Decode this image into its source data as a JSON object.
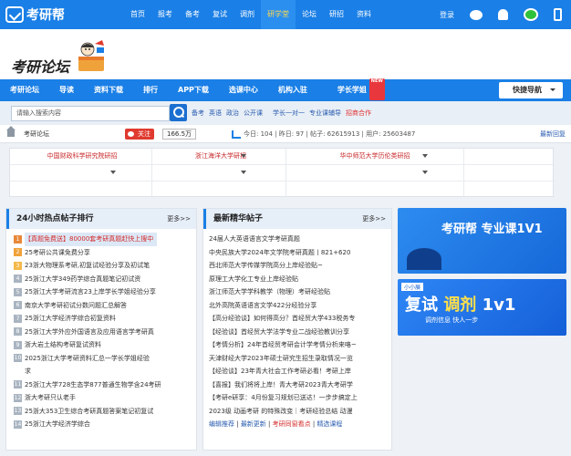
{
  "topbar": {
    "logo": "考研帮",
    "nav": [
      "首页",
      "报考",
      "备考",
      "复试",
      "调剂",
      "研学堂",
      "论坛",
      "研招",
      "资料"
    ],
    "highlight_index": 5,
    "login": "登录",
    "icons": [
      "weibo-icon",
      "bell-icon",
      "wechat-icon",
      "phone-icon"
    ]
  },
  "brand": {
    "title": "考研论坛"
  },
  "mainnav": {
    "items": [
      "考研论坛",
      "导读",
      "资料下载",
      "排行",
      "APP下载",
      "选课中心",
      "机构入驻",
      "学长学姐"
    ],
    "new_badge": "NEW",
    "quick": "快捷导航"
  },
  "search": {
    "placeholder": "请输入搜索内容",
    "tags": [
      "备考",
      "英语",
      "政治",
      "公开课",
      "学长一对一",
      "专业课辅导",
      "招商合作"
    ]
  },
  "stats": {
    "crumb": "考研论坛",
    "follow": "关注",
    "follow_count": "166.5万",
    "today_label": "今日: 104",
    "yesterday_label": "昨日: 97",
    "threads_label": "帖子: 62615913",
    "users_label": "用户: 25603487",
    "newest": "最新回复"
  },
  "link_grid": {
    "row1": [
      "中国财政科学研究院研招",
      "浙江海洋大学研招",
      "华中师范大学历伦类研招"
    ]
  },
  "hot": {
    "title": "24小时热点帖子排行",
    "more": "更多>>",
    "items": [
      {
        "n": "1",
        "text": "【真题免费送】80000套考研真题赶快上搜中"
      },
      {
        "n": "2",
        "text": "25考研公共课免费分享"
      },
      {
        "n": "3",
        "text": "23浙大物理系考研,初复试经验分享及初试笔"
      },
      {
        "n": "4",
        "text": "25浙江大学349药学综合真题笔记初试资"
      },
      {
        "n": "5",
        "text": "25浙江大学考研流言23上岸学长学姐经验分享"
      },
      {
        "n": "6",
        "text": "南京大学考研初试分数问题汇总解答"
      },
      {
        "n": "7",
        "text": "25浙江大学经济学综合初复资料"
      },
      {
        "n": "8",
        "text": "25浙江大学外应外国语言及应用语言学考研真"
      },
      {
        "n": "9",
        "text": "浙大岩土结构考研复试资料"
      },
      {
        "n": "10",
        "text": "2025浙江大学考研资料汇总一学长学姐经验"
      },
      {
        "n": "",
        "text": "求"
      },
      {
        "n": "11",
        "text": "25浙江大学728生态学877普通生物学含24考研"
      },
      {
        "n": "12",
        "text": "浙大考研只认老手"
      },
      {
        "n": "13",
        "text": "25浙大353卫生综合考研真题答案笔记初复试"
      },
      {
        "n": "14",
        "text": "25浙江大学经济学综合"
      }
    ]
  },
  "essence": {
    "title": "最新精华帖子",
    "more": "更多>>",
    "items": [
      "24届人大英语语言文学考研真题",
      "中央民族大学2024年文学院考研真题丨821+620",
      "西北师范大学传媒学院高分上岸经验贴~",
      "原理工大学化工专业上岸经验贴",
      "浙江师范大学学科教学（物理）考研经验贴",
      "北外高院英语语言文学422分经验分享",
      "【高分经验谈】如何得高分？首经贸大学433税务专",
      "【经验谈】首经贸大学法学专业二战经验教训分享",
      "【考情分析】24年首经贸考研会计学考情分析来咯~",
      "天津财经大学2023年硕士研究生招生录取情况一览",
      "【经验谈】23年青大社会工作考研必看！考研上岸",
      "【喜报】我们将将上岸！青大考研2023青大考研学",
      "【考研e研享：4月份复习规划已送达！一步步搞定上",
      "2023级 动画考研 的特殊改变｜考研经验总结 动漫"
    ],
    "footer": [
      "编辑推荐",
      "最新更新",
      "考研同窗看点",
      "精选课程"
    ]
  },
  "ads": {
    "ad1_text": "考研帮 专业课1V1",
    "ad2_tag": "小小展",
    "ad2_a": "复试",
    "ad2_b": "调剂",
    "ad2_c": "1v1",
    "ad2_slogan": "调剂信息 快人一步"
  },
  "colors": {
    "primary": "#1a7fe6",
    "accent_red": "#e03a2f",
    "highlight": "#ffd94a"
  }
}
